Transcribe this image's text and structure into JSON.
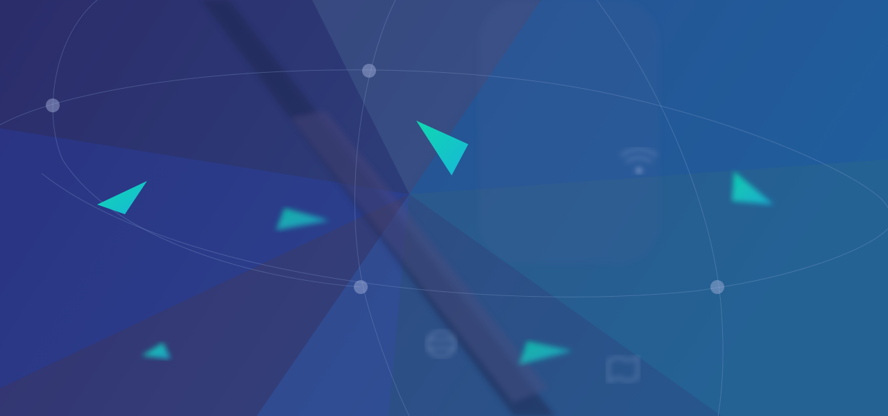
{
  "banner": {
    "colors": {
      "bg_left": "#2b2f6e",
      "bg_right": "#1f5f9a",
      "accent_start": "#0fd8b0",
      "accent_end": "#17b8d8",
      "line": "#8fa8d8"
    },
    "icons": [
      "wifi-icon",
      "map-icon",
      "signal-icon"
    ]
  }
}
